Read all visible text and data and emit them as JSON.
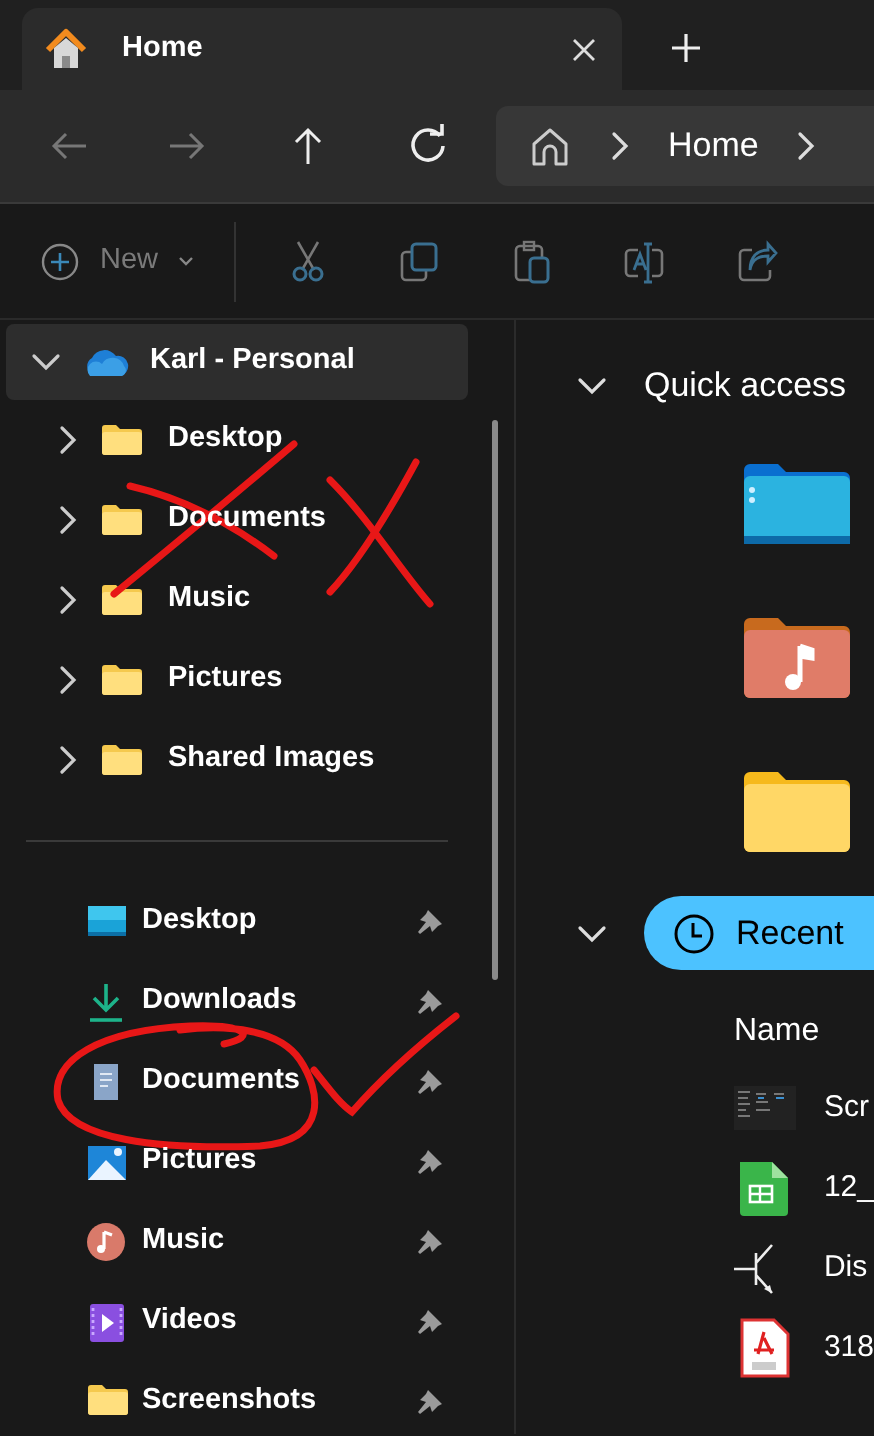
{
  "tabs": [
    {
      "title": "Home",
      "selected": true
    }
  ],
  "nav_buttons": [
    {
      "kind": "back",
      "disabled": true
    },
    {
      "kind": "forward",
      "disabled": true
    },
    {
      "kind": "up",
      "disabled": false
    },
    {
      "kind": "refresh",
      "disabled": false
    }
  ],
  "address_bar": {
    "crumbs": [
      "Home"
    ]
  },
  "command_bar": {
    "new_button": {
      "label": "New",
      "disabled": true
    },
    "tools": [
      {
        "kind": "cut",
        "disabled": true
      },
      {
        "kind": "copy",
        "disabled": true
      },
      {
        "kind": "paste",
        "disabled": true
      },
      {
        "kind": "rename",
        "disabled": true
      },
      {
        "kind": "share",
        "disabled": true
      }
    ]
  },
  "sidebar": {
    "account": {
      "label": "Karl - Personal",
      "expanded": true,
      "selected": true,
      "children": [
        {
          "label": "Desktop",
          "expanded": false
        },
        {
          "label": "Documents",
          "expanded": false
        },
        {
          "label": "Music",
          "expanded": false
        },
        {
          "label": "Pictures",
          "expanded": false
        },
        {
          "label": "Shared Images",
          "expanded": false
        }
      ]
    },
    "quick_items": [
      {
        "label": "Desktop",
        "kind": "desktop",
        "pinned": true
      },
      {
        "label": "Downloads",
        "kind": "downloads",
        "pinned": true
      },
      {
        "label": "Documents",
        "kind": "documents",
        "pinned": true
      },
      {
        "label": "Pictures",
        "kind": "pictures",
        "pinned": true
      },
      {
        "label": "Music",
        "kind": "music",
        "pinned": true
      },
      {
        "label": "Videos",
        "kind": "videos",
        "pinned": true
      },
      {
        "label": "Screenshots",
        "kind": "folder",
        "pinned": true
      }
    ]
  },
  "quick_access": {
    "title": "Quick access",
    "expanded": true,
    "folders": [
      {
        "kind": "desktop"
      },
      {
        "kind": "music"
      },
      {
        "kind": "folder"
      }
    ]
  },
  "recent": {
    "title": "Recent",
    "expanded": true,
    "selected": true,
    "column": "Name",
    "files": [
      {
        "kind": "screenshot",
        "name": "Scr"
      },
      {
        "kind": "spreadsheet",
        "name": "12_"
      },
      {
        "kind": "diagram",
        "name": "Dis"
      },
      {
        "kind": "pdf",
        "name": "318"
      }
    ]
  },
  "annotations": [
    {
      "kind": "cross"
    },
    {
      "kind": "cross"
    },
    {
      "kind": "circle"
    },
    {
      "kind": "check"
    }
  ]
}
